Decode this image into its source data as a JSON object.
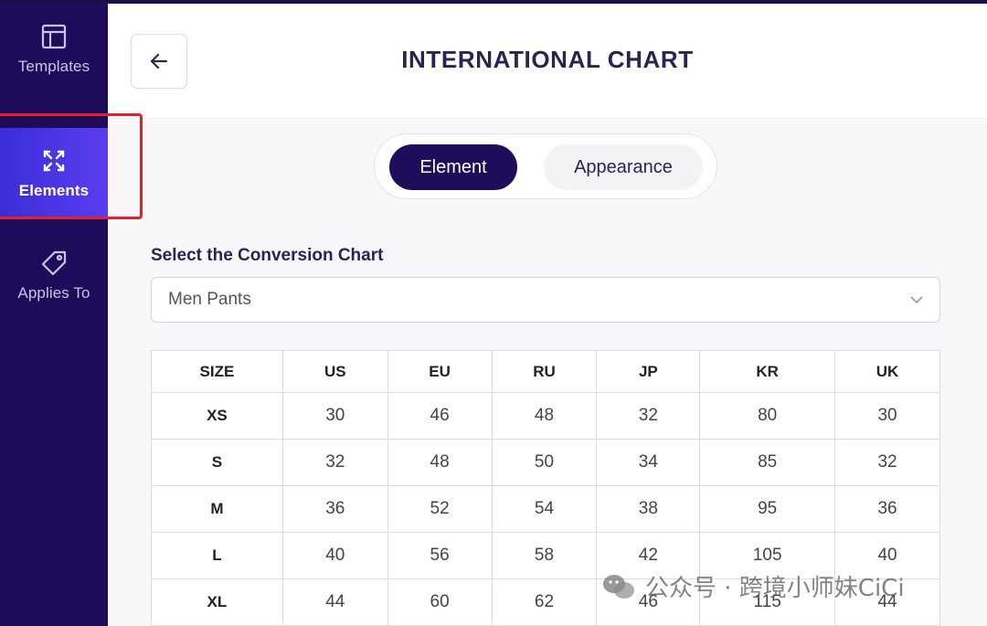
{
  "sidebar": {
    "items": [
      {
        "label": "Templates",
        "icon": "layout-icon"
      },
      {
        "label": "Elements",
        "icon": "expand-arrows-icon",
        "active": true
      },
      {
        "label": "Applies To",
        "icon": "tag-icon"
      }
    ]
  },
  "header": {
    "title": "INTERNATIONAL CHART"
  },
  "tabs": [
    {
      "label": "Element",
      "active": true
    },
    {
      "label": "Appearance",
      "active": false
    }
  ],
  "conversion": {
    "label": "Select the Conversion Chart",
    "selected": "Men Pants"
  },
  "table": {
    "headers": [
      "SIZE",
      "US",
      "EU",
      "RU",
      "JP",
      "KR",
      "UK"
    ],
    "rows": [
      [
        "XS",
        "30",
        "46",
        "48",
        "32",
        "80",
        "30"
      ],
      [
        "S",
        "32",
        "48",
        "50",
        "34",
        "85",
        "32"
      ],
      [
        "M",
        "36",
        "52",
        "54",
        "38",
        "95",
        "36"
      ],
      [
        "L",
        "40",
        "56",
        "58",
        "42",
        "105",
        "40"
      ],
      [
        "XL",
        "44",
        "60",
        "62",
        "46",
        "115",
        "44"
      ]
    ]
  },
  "watermark": {
    "text": "公众号 · 跨境小师妹CiCi"
  },
  "colors": {
    "sidebar_bg": "#1e0b5a",
    "active_tab": "#1f0d5c",
    "active_sidebar": "#4a35e6",
    "highlight": "#e4202a"
  }
}
